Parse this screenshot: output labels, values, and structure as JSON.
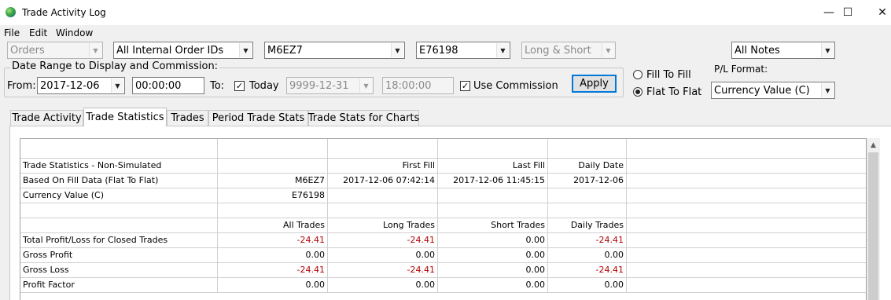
{
  "window": {
    "title": "Trade Activity Log",
    "minimize": "—",
    "maximize": "☐",
    "close": "✕"
  },
  "menu": [
    "File",
    "Edit",
    "Window"
  ],
  "filters": {
    "orders": "Orders",
    "order_ids": "All Internal Order IDs",
    "symbol": "M6EZ7",
    "account": "E76198",
    "side": "Long & Short",
    "notes": "All Notes"
  },
  "date_range": {
    "group_label": "Date Range to Display and Commission:",
    "from_label": "From:",
    "from_date": "2017-12-06",
    "from_time": "00:00:00",
    "to_label": "To:",
    "today_label": "Today",
    "to_date": "9999-12-31",
    "to_time": "18:00:00",
    "use_commission_label": "Use Commission",
    "apply_label": "Apply"
  },
  "fill_mode": {
    "fill_to_fill": "Fill To Fill",
    "flat_to_flat": "Flat To Flat",
    "selected": "flat_to_flat"
  },
  "pl_format": {
    "label": "P/L Format:",
    "value": "Currency Value (C)"
  },
  "tabs": [
    "Trade Activity",
    "Trade Statistics",
    "Trades",
    "Period Trade Stats",
    "Trade Stats for Charts"
  ],
  "active_tab": "Trade Statistics",
  "grid": {
    "rows": [
      [
        "",
        "",
        "",
        "",
        "",
        ""
      ],
      [
        "Trade Statistics - Non-Simulated",
        "",
        "First Fill",
        "Last Fill",
        "Daily Date",
        ""
      ],
      [
        "Based On Fill Data (Flat To Flat)",
        "M6EZ7",
        "2017-12-06  07:42:14",
        "2017-12-06  11:45:15",
        "2017-12-06",
        ""
      ],
      [
        "Currency Value (C)",
        "E76198",
        "",
        "",
        "",
        ""
      ],
      [
        "",
        "",
        "",
        "",
        "",
        ""
      ],
      [
        "",
        "All Trades",
        "Long Trades",
        "Short Trades",
        "Daily Trades",
        ""
      ],
      [
        "Total Profit/Loss for Closed Trades",
        "-24.41",
        "-24.41",
        "0.00",
        "-24.41",
        ""
      ],
      [
        "Gross Profit",
        "0.00",
        "0.00",
        "0.00",
        "0.00",
        ""
      ],
      [
        "Gross Loss",
        "-24.41",
        "-24.41",
        "0.00",
        "-24.41",
        ""
      ],
      [
        "Profit Factor",
        "0.00",
        "0.00",
        "0.00",
        "0.00",
        ""
      ]
    ]
  },
  "colors": {
    "negative": "#b00000",
    "focus": "#0078d7"
  }
}
